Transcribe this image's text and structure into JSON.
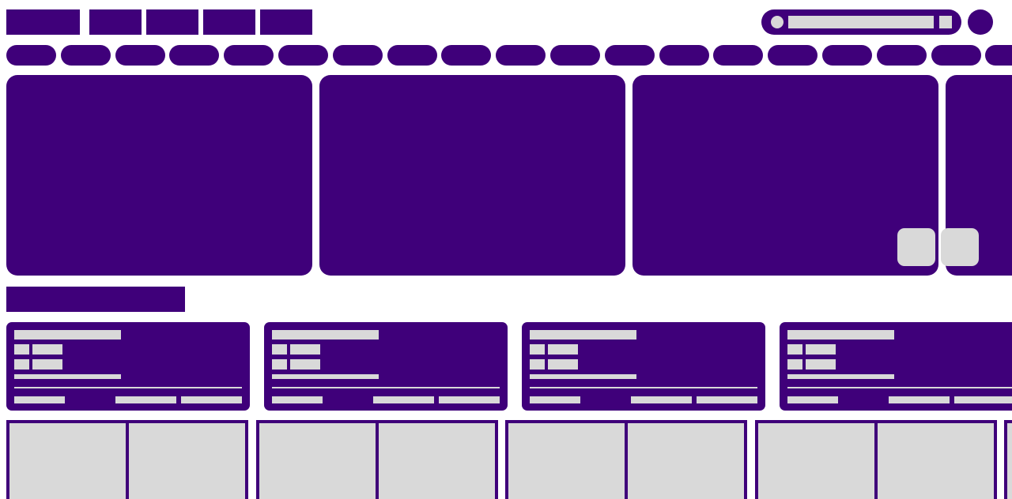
{
  "colors": {
    "ink": "#3f007a",
    "placeholder": "#d9d9d9",
    "background": "#ffffff"
  },
  "header": {
    "nav_buttons": [
      "",
      "",
      "",
      "",
      ""
    ],
    "search": {
      "placeholder": "",
      "value": ""
    },
    "icons": [
      "search-icon",
      "clear-icon",
      "avatar"
    ]
  },
  "chips": [
    "",
    "",
    "",
    "",
    "",
    "",
    "",
    "",
    "",
    "",
    "",
    "",
    "",
    "",
    "",
    "",
    "",
    "",
    ""
  ],
  "carousel": {
    "slides": [
      "",
      "",
      "",
      ""
    ],
    "controls": [
      "prev-slide-icon",
      "next-slide-icon"
    ]
  },
  "section": {
    "title": ""
  },
  "cards": [
    {
      "title": "",
      "row1_key": "",
      "row1_val": "",
      "row2_key": "",
      "row2_val": "",
      "desc": "",
      "foot_left": "",
      "foot_mid": "",
      "foot_right": ""
    },
    {
      "title": "",
      "row1_key": "",
      "row1_val": "",
      "row2_key": "",
      "row2_val": "",
      "desc": "",
      "foot_left": "",
      "foot_mid": "",
      "foot_right": ""
    },
    {
      "title": "",
      "row1_key": "",
      "row1_val": "",
      "row2_key": "",
      "row2_val": "",
      "desc": "",
      "foot_left": "",
      "foot_mid": "",
      "foot_right": ""
    },
    {
      "title": "",
      "row1_key": "",
      "row1_val": "",
      "row2_key": "",
      "row2_val": "",
      "desc": "",
      "foot_left": "",
      "foot_mid": "",
      "foot_right": ""
    }
  ],
  "grid": {
    "tiles": [
      "",
      "",
      "",
      "",
      "",
      "",
      "",
      "",
      ""
    ]
  }
}
